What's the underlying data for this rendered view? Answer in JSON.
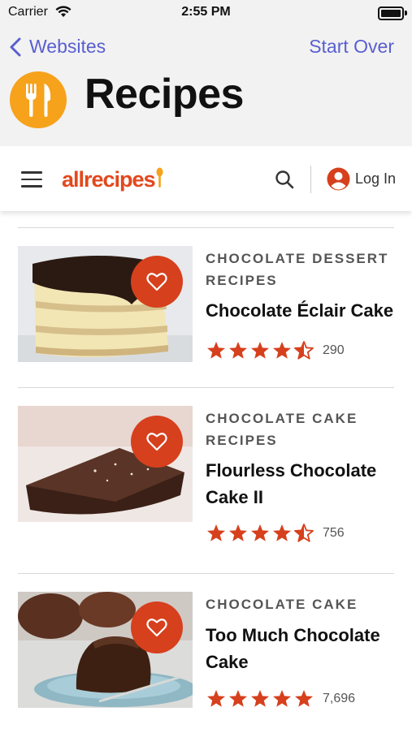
{
  "status": {
    "carrier": "Carrier",
    "time": "2:55 PM"
  },
  "nav": {
    "back_label": "Websites",
    "start_over": "Start Over",
    "title": "Recipes"
  },
  "toolbar": {
    "logo": "allrecipes",
    "login": "Log In"
  },
  "colors": {
    "accent": "#5a5fd0",
    "brand": "#e2481d",
    "heart": "#d6401d",
    "app_icon": "#f7a21b"
  },
  "recipes": [
    {
      "category": "CHOCOLATE DESSERT RECIPES",
      "title": "Chocolate Éclair Cake",
      "rating": 4.5,
      "count": "290"
    },
    {
      "category": "CHOCOLATE CAKE RECIPES",
      "title": "Flourless Chocolate Cake II",
      "rating": 4.5,
      "count": "756"
    },
    {
      "category": "CHOCOLATE CAKE",
      "title": "Too Much Chocolate Cake",
      "rating": 5,
      "count": "7,696"
    }
  ]
}
